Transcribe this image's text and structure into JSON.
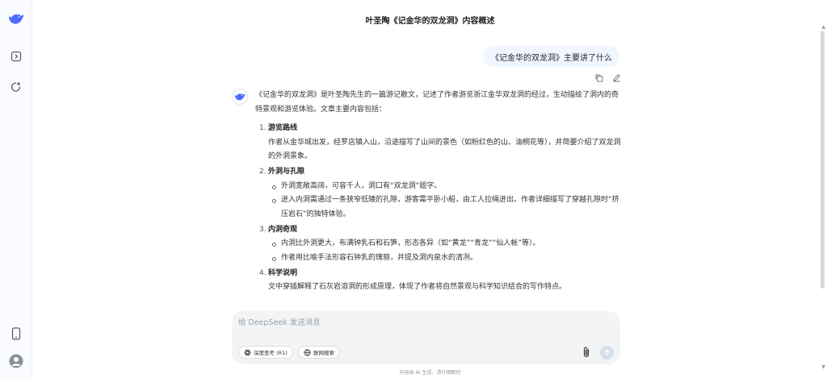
{
  "app": {
    "title": "叶圣陶《记金华的双龙洞》内容概述"
  },
  "sidebar": {
    "icons": [
      "deepseek-logo-icon",
      "sidebar-toggle-icon",
      "new-chat-icon",
      "phone-icon",
      "user-avatar-icon"
    ]
  },
  "chat": {
    "user_message": "《记金华的双龙洞》主要讲了什么",
    "answer": {
      "intro": "《记金华的双龙洞》是叶圣陶先生的一篇游记散文，记述了作者游览浙江金华双龙洞的经过，生动描绘了洞内的奇特景观和游览体验。文章主要内容包括：",
      "sections": [
        {
          "num": "1.",
          "title": "游览路线",
          "text": "作者从金华城出发，经罗店镇入山，沿途描写了山间的景色（如粉红色的山、油桐花等），并简要介绍了双龙洞的外洞景象。",
          "bullets": []
        },
        {
          "num": "2.",
          "title": "外洞与孔隙",
          "text": "",
          "bullets": [
            "外洞宽敞高阔，可容千人，洞口有“双龙洞”题字。",
            "进入内洞需通过一条狭窄低矮的孔隙，游客需平卧小船，由工人拉绳进出。作者详细描写了穿越孔隙时“挤压岩石”的独特体验。"
          ]
        },
        {
          "num": "3.",
          "title": "内洞奇观",
          "text": "",
          "bullets": [
            "内洞比外洞更大，布满钟乳石和石笋，形态各异（如“黄龙”“青龙”“仙人帐”等）。",
            "作者用比喻手法形容石钟乳的瑰丽，并提及洞内泉水的清冽。"
          ]
        },
        {
          "num": "4.",
          "title": "科学说明",
          "text": "文中穿插解释了石灰岩溶洞的形成原理，体现了作者将自然景观与科学知识结合的写作特点。",
          "bullets": []
        }
      ]
    }
  },
  "composer": {
    "placeholder": "给 DeepSeek 发送消息",
    "deep_think_label": "深度思考 (R1)",
    "web_search_label": "联网搜索"
  },
  "footer": {
    "note": "内容由 AI 生成，请仔细甄别"
  },
  "colors": {
    "brand": "#4d6bfe",
    "bubble": "#eff6ff",
    "composer_bg": "#f3f4f6"
  }
}
